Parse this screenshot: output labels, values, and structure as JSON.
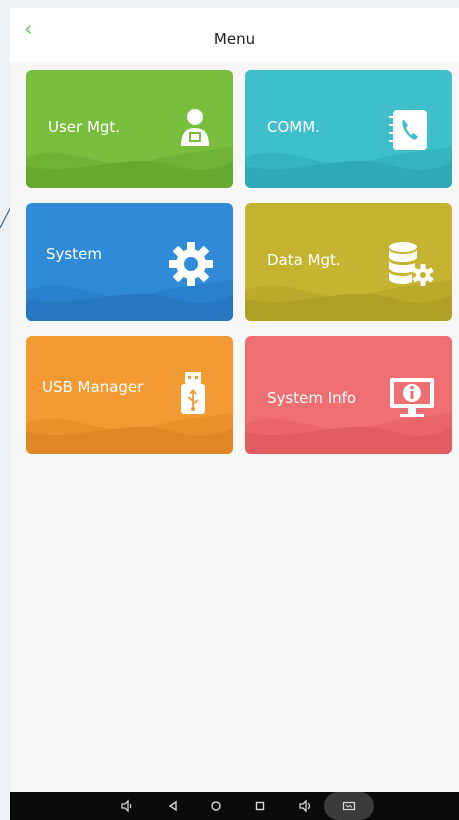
{
  "header": {
    "back_icon": "chevron-left-icon",
    "title": "Menu"
  },
  "tiles": [
    {
      "label": "User Mgt.",
      "color": "#79bf3d",
      "icon": "user-icon"
    },
    {
      "label": "COMM.",
      "color": "#3fbecb",
      "icon": "phone-book-icon"
    },
    {
      "label": "System",
      "color": "#2f8ad8",
      "icon": "gear-icon"
    },
    {
      "label": "Data Mgt.",
      "color": "#c6b330",
      "icon": "database-gear-icon"
    },
    {
      "label": "USB Manager",
      "color": "#f39a33",
      "icon": "usb-drive-icon"
    },
    {
      "label": "System Info",
      "color": "#ef6f73",
      "icon": "monitor-info-icon"
    }
  ],
  "navbar": {
    "icons": [
      "volume-down-icon",
      "back-triangle-icon",
      "home-circle-icon",
      "recents-square-icon",
      "volume-up-icon",
      "screenshot-icon"
    ],
    "background": "#0a0a0a"
  }
}
